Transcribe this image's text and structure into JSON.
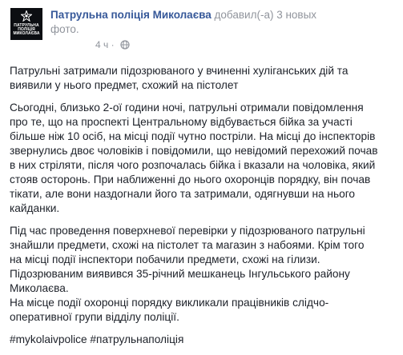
{
  "post": {
    "avatar": {
      "line1": "ПАТРУЛЬНА",
      "line2": "ПОЛІЦІЯ",
      "line3": "МИКОЛАЄВА"
    },
    "author": "Патрульна поліція Миколаєва",
    "action": "добавил(-а) 3 новых",
    "action_cont": "фото.",
    "time": "4 ч",
    "separator": "·",
    "paragraphs": [
      "Патрульні затримали підозрюваного у вчиненні хуліганських дій та\nвиявили у нього предмет, схожий на пістолет",
      "Сьогодні, близько 2-ої години ночі, патрульні отримали повідомлення\nпро те, що на проспекті Центральному відбувається бійка за участі\nбільше ніж 10 осіб, на місці події чутно постріли. На місці до інспекторів\nзвернулись двоє чоловіків і повідомили, що невідомий перехожий почав\nв них стріляти, після чого розпочалась бійка і вказали на чоловіка, який\nстояв осторонь. При наближенні до нього охоронців порядку, він почав\nтікати, але вони наздогнали його та затримали, одягнувши на нього\nкайданки.",
      "Під час проведення поверхневої перевірки у підозрюваного патрульні\nзнайшли предмети, схожі на пістолет та магазин з набоями. Крім того\nна місці події інспектори побачили предмети, схожі на гілизи.\nПідозрюваним виявився 35-річний мешканець Інгульського району\nМиколаєва.\nНа місце події охоронці порядку викликали працівників слідчо-\nоперативної групи відділу поліції.",
      "#mykolaivpolice #патрульнаполіція"
    ]
  },
  "colors": {
    "link": "#365899",
    "meta": "#90949c",
    "text": "#1d2129"
  },
  "icons": {
    "avatar_badge": "police-badge-icon",
    "privacy": "globe-icon"
  }
}
